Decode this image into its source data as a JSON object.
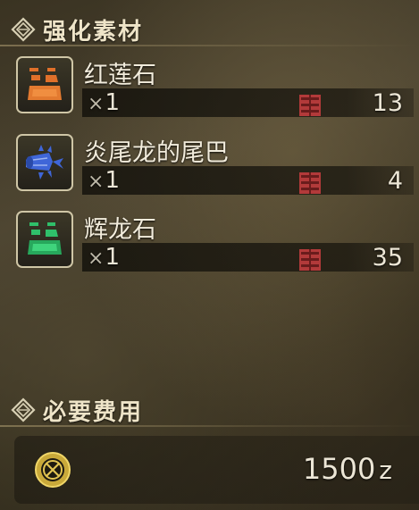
{
  "materials_header": {
    "title": "强化素材",
    "icon": "diamond-emblem-icon"
  },
  "materials": [
    {
      "name": "红莲石",
      "qty_prefix": "×",
      "quantity": "1",
      "owned": "13",
      "icon": "ore-icon",
      "color": "#e0702a"
    },
    {
      "name": "炎尾龙的尾巴",
      "qty_prefix": "×",
      "quantity": "1",
      "owned": "4",
      "icon": "tail-icon",
      "color": "#3f66d8"
    },
    {
      "name": "辉龙石",
      "qty_prefix": "×",
      "quantity": "1",
      "owned": "35",
      "icon": "ore-icon",
      "color": "#2fbf6a"
    }
  ],
  "storage_icon": "item-box-icon",
  "cost_header": {
    "title": "必要费用",
    "icon": "diamond-emblem-icon"
  },
  "cost": {
    "value": "1500",
    "unit": "z",
    "icon": "zenny-coin-icon"
  }
}
